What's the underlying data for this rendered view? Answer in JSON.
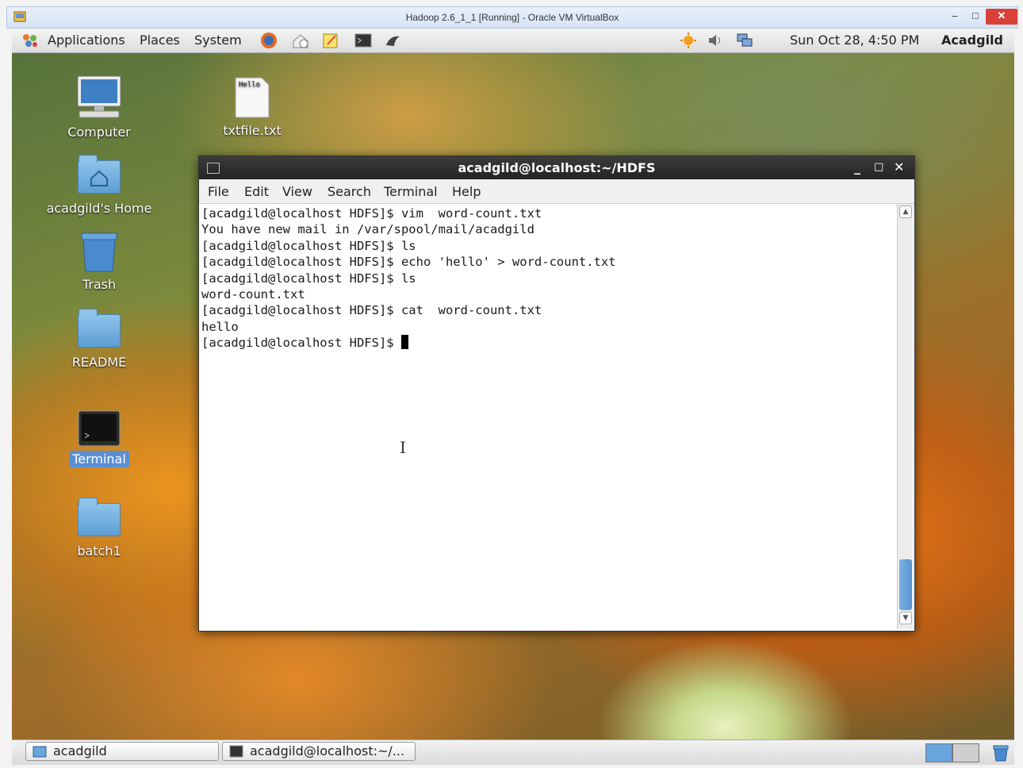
{
  "host_window": {
    "title": "Hadoop 2.6_1_1 [Running] - Oracle VM VirtualBox",
    "minimize": "–",
    "maximize": "□",
    "close": "✕"
  },
  "top_panel": {
    "menus": [
      "Applications",
      "Places",
      "System"
    ],
    "launchers": [
      "firefox-icon",
      "mail-icon",
      "notes-icon",
      "terminal-icon",
      "dolphin-icon"
    ],
    "tray": [
      "update-icon",
      "volume-icon",
      "network-icon"
    ],
    "clock": "Sun Oct 28,  4:50 PM",
    "user": "Acadgild"
  },
  "desktop": {
    "icons": [
      {
        "label": "Computer",
        "icon": "computer-icon"
      },
      {
        "label": "txtfile.txt",
        "icon": "text-file-icon",
        "preview": "Hello"
      },
      {
        "label": "acadgild's Home",
        "icon": "home-folder-icon"
      },
      {
        "label": "Trash",
        "icon": "trash-icon"
      },
      {
        "label": "README",
        "icon": "folder-icon"
      },
      {
        "label": "Terminal",
        "icon": "terminal-icon",
        "selected": true
      },
      {
        "label": "batch1",
        "icon": "folder-icon"
      }
    ]
  },
  "terminal": {
    "title": "acadgild@localhost:~/HDFS",
    "menu": [
      "File",
      "Edit",
      "View",
      "Search",
      "Terminal",
      "Help"
    ],
    "lines": [
      "[acadgild@localhost HDFS]$ vim  word-count.txt",
      "You have new mail in /var/spool/mail/acadgild",
      "[acadgild@localhost HDFS]$ ls",
      "[acadgild@localhost HDFS]$ echo 'hello' > word-count.txt",
      "[acadgild@localhost HDFS]$ ls",
      "word-count.txt",
      "[acadgild@localhost HDFS]$ cat  word-count.txt",
      "hello"
    ],
    "prompt": "[acadgild@localhost HDFS]$ "
  },
  "bottom_panel": {
    "tasks": [
      "acadgild",
      "acadgild@localhost:~/..."
    ]
  },
  "colors": {
    "selection": "#5b8fd4",
    "terminal_titlebar": "#2b2b2b",
    "vbox_close": "#d9403a"
  }
}
